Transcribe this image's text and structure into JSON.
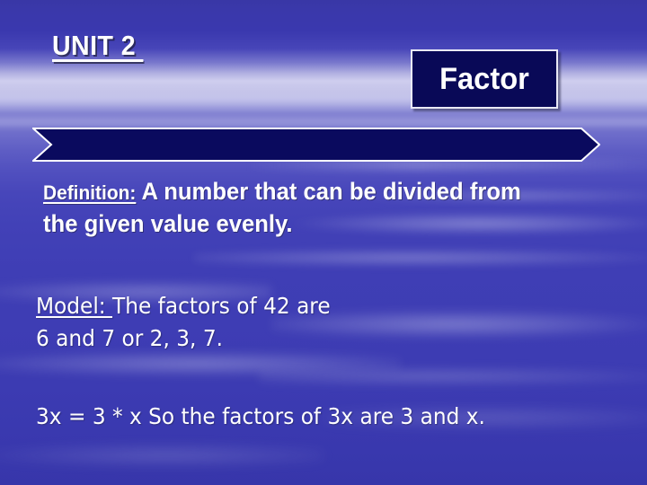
{
  "slide": {
    "unit_title": "UNIT 2 ",
    "term_box": {
      "label": "Factor"
    },
    "definition": {
      "label": "Definition:",
      "text": " A number that can be divided from the given value evenly."
    },
    "model": {
      "label": "Model: ",
      "line1": "The factors of 42 are",
      "line2": "6 and 7 or 2, 3, 7."
    },
    "expression": {
      "text": "3x = 3 * x So the factors of 3x are 3 and x."
    },
    "colors": {
      "box_fill": "#090957",
      "box_border": "#e9e9f6",
      "banner_fill": "#0a0a5e",
      "banner_border": "#ffffff",
      "text": "#ffffff",
      "background_top": "#3937a6",
      "background_band": "#cfceee",
      "background_body": "#3e3db4"
    }
  }
}
